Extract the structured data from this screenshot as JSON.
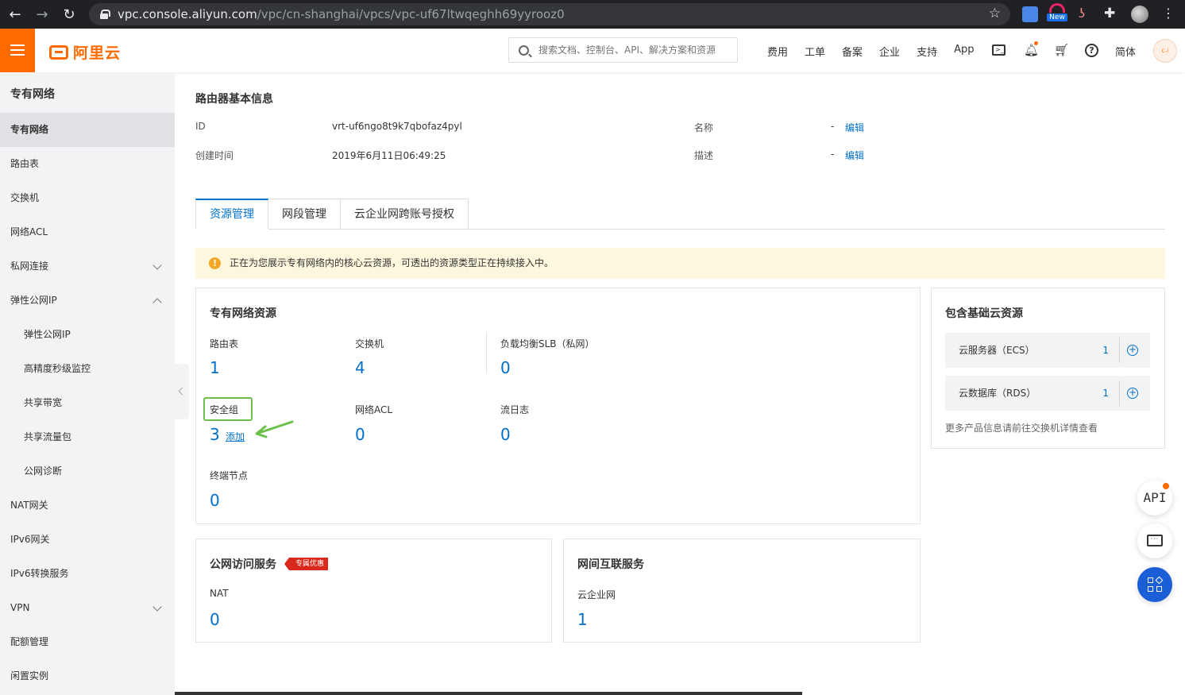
{
  "browser": {
    "url_host": "vpc.console.aliyun.com",
    "url_path": "/vpc/cn-shanghai/vpcs/vpc-uf67ltwqeghh69yyrooz0",
    "ext_new_badge": "New"
  },
  "header": {
    "logo_text": "阿里云",
    "search_placeholder": "搜索文档、控制台、API、解决方案和资源",
    "nav": [
      "费用",
      "工单",
      "备案",
      "企业",
      "支持",
      "App"
    ],
    "lang": "简体",
    "accent_color": "#ff6a00"
  },
  "sidebar": {
    "title": "专有网络",
    "items": [
      {
        "label": "专有网络",
        "active": true
      },
      {
        "label": "路由表"
      },
      {
        "label": "交换机"
      },
      {
        "label": "网络ACL"
      },
      {
        "label": "私网连接",
        "chevron": "down"
      },
      {
        "label": "弹性公网IP",
        "chevron": "up"
      },
      {
        "label": "弹性公网IP",
        "sub": true
      },
      {
        "label": "高精度秒级监控",
        "sub": true
      },
      {
        "label": "共享带宽",
        "sub": true
      },
      {
        "label": "共享流量包",
        "sub": true
      },
      {
        "label": "公网诊断",
        "sub": true
      },
      {
        "label": "NAT网关"
      },
      {
        "label": "IPv6网关"
      },
      {
        "label": "IPv6转换服务"
      },
      {
        "label": "VPN",
        "chevron": "down"
      },
      {
        "label": "配额管理"
      },
      {
        "label": "闲置实例"
      }
    ]
  },
  "router_info": {
    "title": "路由器基本信息",
    "id_label": "ID",
    "id_value": "vrt-uf6ngo8t9k7qbofaz4pyl",
    "created_label": "创建时间",
    "created_value": "2019年6月11日06:49:25",
    "name_label": "名称",
    "name_value": "-",
    "desc_label": "描述",
    "desc_value": "-",
    "edit_label": "编辑"
  },
  "tabs": [
    "资源管理",
    "网段管理",
    "云企业网跨账号授权"
  ],
  "notice": {
    "text": "正在为您展示专有网络内的核心云资源，可透出的资源类型正在持续接入中。"
  },
  "vpc_resources": {
    "title": "专有网络资源",
    "metrics": [
      {
        "label": "路由表",
        "value": "1"
      },
      {
        "label": "交换机",
        "value": "4"
      },
      {
        "label": "负载均衡SLB（私网）",
        "value": "0"
      },
      {
        "label": "安全组",
        "value": "3"
      },
      {
        "label": "网络ACL",
        "value": "0"
      },
      {
        "label": "流日志",
        "value": "0"
      },
      {
        "label": "终端节点",
        "value": "0"
      }
    ],
    "add_label": "添加"
  },
  "public_access": {
    "title": "公网访问服务",
    "tag": "专属优惠",
    "metric_label": "NAT",
    "metric_value": "0"
  },
  "interconnect": {
    "title": "网间互联服务",
    "metric_label": "云企业网",
    "metric_value": "1"
  },
  "basic_cloud": {
    "title": "包含基础云资源",
    "rows": [
      {
        "label": "云服务器（ECS）",
        "count": "1"
      },
      {
        "label": "云数据库（RDS）",
        "count": "1"
      }
    ],
    "more": "更多产品信息请前往交换机详情查看"
  },
  "fabs": {
    "api": "API"
  }
}
